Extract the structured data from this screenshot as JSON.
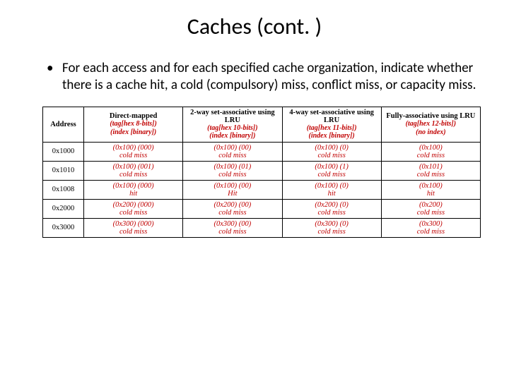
{
  "title": "Caches (cont. )",
  "bullet": "For each access and for each specified cache organization, indicate whether there is a cache hit, a cold (compulsory) miss, conflict miss, or capacity miss.",
  "headers": {
    "c0": "Address",
    "c1": {
      "top": "Direct-mapped",
      "tag": "(tag[hex 8-bits])",
      "idx": "(index [binary])"
    },
    "c2": {
      "top": "2-way set-associative using LRU",
      "tag": "(tag[hex 10-bits])",
      "idx": "(index [binary])"
    },
    "c3": {
      "top": "4-way set-associative using LRU",
      "tag": "(tag[hex 11-bits])",
      "idx": "(index [binary])"
    },
    "c4": {
      "top": "Fully-associative using LRU",
      "tag": "(tag[hex 12-bits])",
      "idx": "(no index)"
    }
  },
  "rows": [
    {
      "addr": "0x1000",
      "c1": {
        "v": "(0x100) (000)",
        "r": "cold miss"
      },
      "c2": {
        "v": "(0x100) (00)",
        "r": "cold miss"
      },
      "c3": {
        "v": "(0x100) (0)",
        "r": "cold miss"
      },
      "c4": {
        "v": "(0x100)",
        "r": "cold miss"
      }
    },
    {
      "addr": "0x1010",
      "c1": {
        "v": "(0x100) (001)",
        "r": "cold miss"
      },
      "c2": {
        "v": "(0x100) (01)",
        "r": "cold miss"
      },
      "c3": {
        "v": "(0x100) (1)",
        "r": "cold miss"
      },
      "c4": {
        "v": "(0x101)",
        "r": "cold miss"
      }
    },
    {
      "addr": "0x1008",
      "c1": {
        "v": "(0x100) (000)",
        "r": "hit"
      },
      "c2": {
        "v": "(0x100) (00)",
        "r": "Hit"
      },
      "c3": {
        "v": "(0x100) (0)",
        "r": "hit"
      },
      "c4": {
        "v": "(0x100)",
        "r": "hit"
      }
    },
    {
      "addr": "0x2000",
      "c1": {
        "v": "(0x200) (000)",
        "r": "cold miss"
      },
      "c2": {
        "v": "(0x200) (00)",
        "r": "cold miss"
      },
      "c3": {
        "v": "(0x200) (0)",
        "r": "cold miss"
      },
      "c4": {
        "v": "(0x200)",
        "r": "cold miss"
      }
    },
    {
      "addr": "0x3000",
      "c1": {
        "v": "(0x300) (000)",
        "r": "cold miss"
      },
      "c2": {
        "v": "(0x300) (00)",
        "r": "cold miss"
      },
      "c3": {
        "v": "(0x300) (0)",
        "r": "cold miss"
      },
      "c4": {
        "v": "(0x300)",
        "r": "cold miss"
      }
    }
  ]
}
